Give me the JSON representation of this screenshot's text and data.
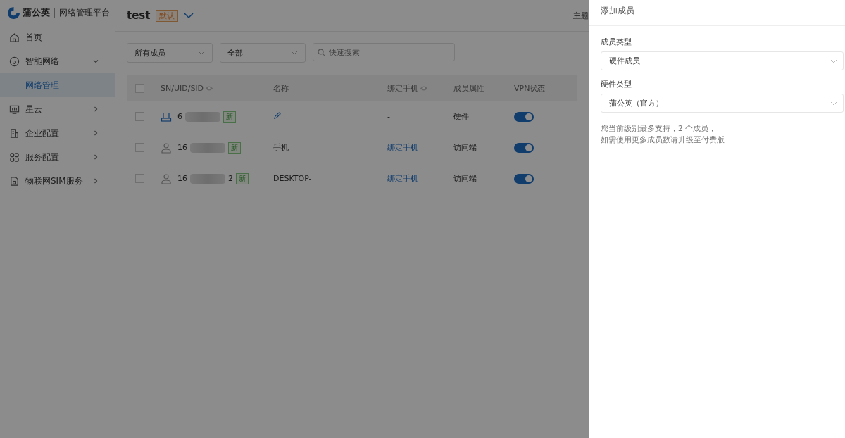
{
  "logo": {
    "brand": "蒲公英",
    "product": "网络管理平台"
  },
  "header": {
    "network": "test",
    "badge": "默认",
    "theme": "主题"
  },
  "sidebar": {
    "items": [
      {
        "label": "首页",
        "kind": "home",
        "selected": false
      },
      {
        "label": "智能网络",
        "kind": "network",
        "selected": false,
        "expanded": true,
        "children": [
          {
            "label": "网络管理",
            "selected": true
          }
        ]
      },
      {
        "label": "星云",
        "kind": "monitor",
        "selected": false,
        "expanded": false
      },
      {
        "label": "企业配置",
        "kind": "building",
        "selected": false,
        "expanded": false
      },
      {
        "label": "服务配置",
        "kind": "grid",
        "selected": false,
        "expanded": false
      },
      {
        "label": "物联网SIM服务",
        "kind": "sim",
        "selected": false,
        "expanded": false
      }
    ]
  },
  "filters": [
    {
      "value": "所有成员"
    },
    {
      "value": "全部"
    }
  ],
  "search": {
    "placeholder": "快速搜索"
  },
  "table": {
    "select_all_checked": false,
    "columns": [
      {
        "label": "SN/UID/SID",
        "eye": true
      },
      {
        "label": "名称",
        "eye": false
      },
      {
        "label": "绑定手机",
        "eye": true
      },
      {
        "label": "成员属性",
        "eye": false
      },
      {
        "label": "VPN状态",
        "eye": false
      }
    ],
    "rows": [
      {
        "kind": "router",
        "checked": false,
        "sn_start": "6",
        "sn_end": "",
        "badge": "新",
        "name": "",
        "edit": true,
        "phone": "-",
        "phone_link": false,
        "attribute": "硬件",
        "vpn_on": true
      },
      {
        "kind": "user",
        "checked": false,
        "sn_start": "16",
        "sn_end": "",
        "badge": "新",
        "name": "手机",
        "edit": false,
        "phone": "绑定手机",
        "phone_link": true,
        "attribute": "访问端",
        "vpn_on": true
      },
      {
        "kind": "user",
        "checked": false,
        "sn_start": "16",
        "sn_end": "2",
        "badge": "新",
        "name": "DESKTOP-",
        "edit": false,
        "phone": "绑定手机",
        "phone_link": true,
        "attribute": "访问端",
        "vpn_on": true
      }
    ]
  },
  "drawer": {
    "title": "添加成员",
    "fields": [
      {
        "label": "成员类型",
        "value": "硬件成员"
      },
      {
        "label": "硬件类型",
        "value": "蒲公英（官方）"
      }
    ],
    "note": [
      "您当前级别最多支持，2 个成员，",
      "如需使用更多成员数请升级至付费版"
    ]
  }
}
